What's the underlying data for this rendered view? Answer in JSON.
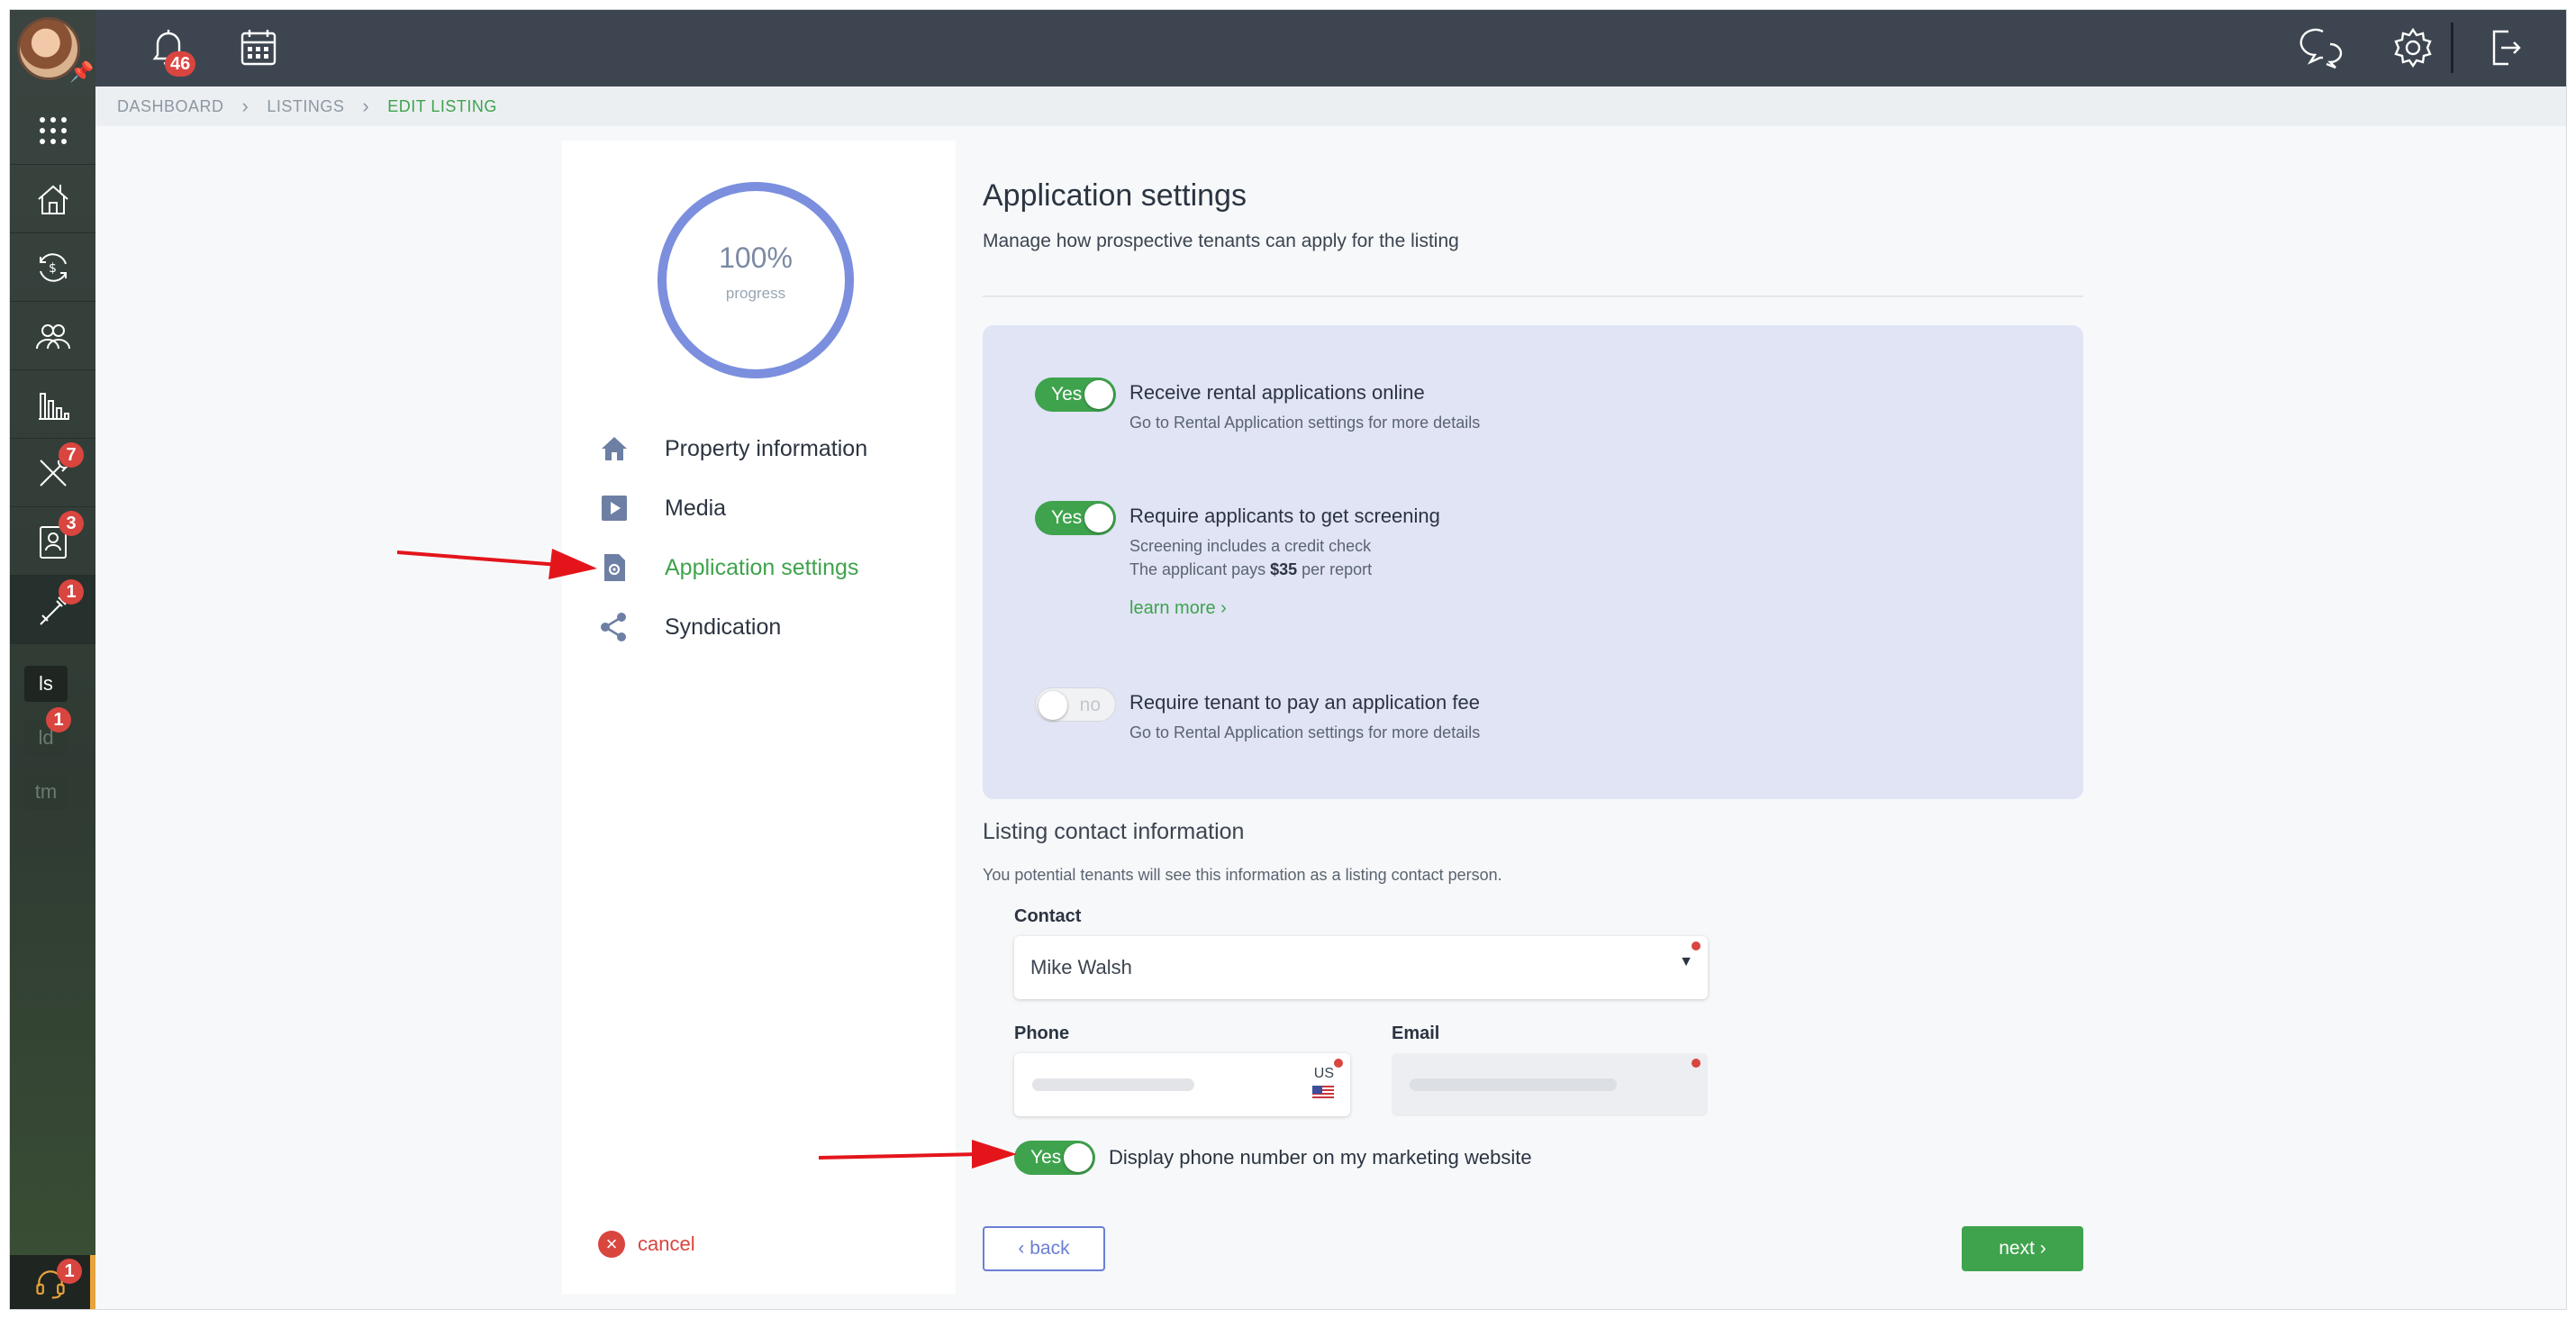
{
  "topbar": {
    "notifications_count": "46",
    "icons": [
      "bell-icon",
      "calendar-icon",
      "chat-icon",
      "gear-icon",
      "logout-icon"
    ]
  },
  "sidebar": {
    "badges": {
      "maintenance": "7",
      "tenants": "3",
      "tools": "1",
      "ld": "1",
      "support": "1"
    },
    "tags": [
      "ls",
      "ld",
      "tm"
    ]
  },
  "breadcrumb": {
    "items": [
      "DASHBOARD",
      "LISTINGS",
      "EDIT LISTING"
    ]
  },
  "progress": {
    "value": "100%",
    "label": "progress",
    "fraction": 1.0
  },
  "steps": [
    {
      "label": "Property information",
      "icon": "home-icon"
    },
    {
      "label": "Media",
      "icon": "play-icon"
    },
    {
      "label": "Application settings",
      "icon": "settings-doc-icon"
    },
    {
      "label": "Syndication",
      "icon": "share-icon"
    }
  ],
  "cancel_label": "cancel",
  "main": {
    "title": "Application settings",
    "subtitle": "Manage how prospective tenants can apply for the listing",
    "options": [
      {
        "toggle": "Yes",
        "title": "Receive rental applications online",
        "note": "Go to Rental Application settings for more details"
      },
      {
        "toggle": "Yes",
        "title": "Require applicants to get screening",
        "note1": "Screening includes a credit check",
        "note2_prefix": "The applicant pays ",
        "note2_amount": "$35",
        "note2_suffix": " per report",
        "link": "learn more ›"
      },
      {
        "toggle": "no",
        "title": "Require tenant to pay an application fee",
        "note": "Go to Rental Application settings for more details"
      }
    ],
    "contact_heading": "Listing contact information",
    "contact_desc": "You potential tenants will see this information as a listing contact person.",
    "contact_label": "Contact",
    "contact_value": "Mike Walsh",
    "phone_label": "Phone",
    "phone_country": "US",
    "email_label": "Email",
    "display_phone_toggle": "Yes",
    "display_phone_label": "Display phone number on my marketing website",
    "back_label": "‹  back",
    "next_label": "next  ›"
  },
  "colors": {
    "accent_green": "#3fa34d",
    "ring": "#7b8fde",
    "panel": "#e0e4f5",
    "badge_red": "#d9453f",
    "arrow_red": "#e3151b"
  }
}
